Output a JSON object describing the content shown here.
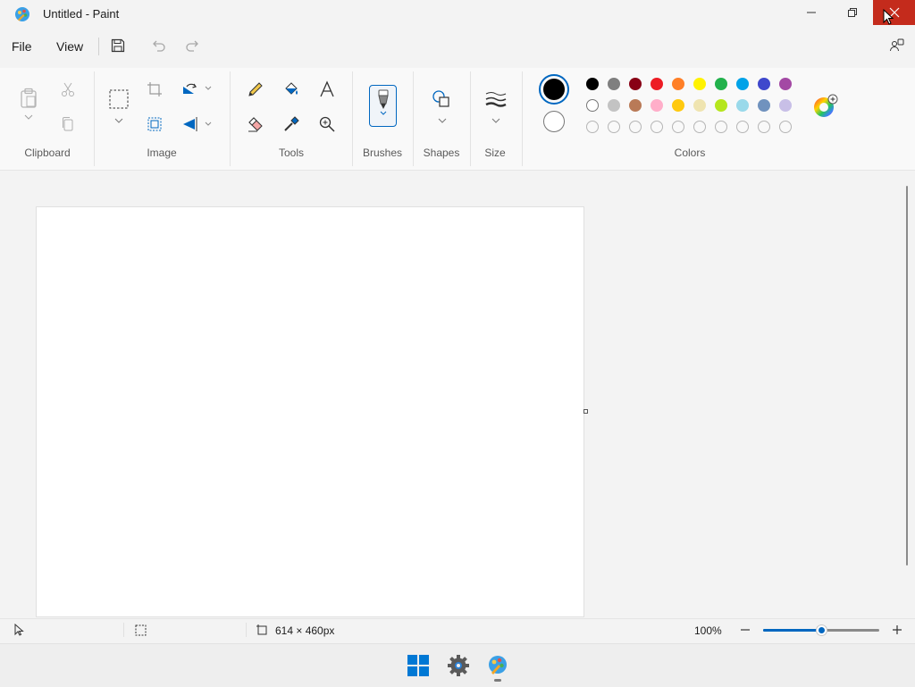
{
  "window": {
    "title": "Untitled - Paint"
  },
  "menu": {
    "file": "File",
    "view": "View"
  },
  "ribbon": {
    "groups": {
      "clipboard": "Clipboard",
      "image": "Image",
      "tools": "Tools",
      "brushes": "Brushes",
      "shapes": "Shapes",
      "size": "Size",
      "colors": "Colors"
    }
  },
  "colors": {
    "primary": "#000000",
    "secondary": "#ffffff",
    "row1": [
      "#000000",
      "#7f7f7f",
      "#880015",
      "#ed1c24",
      "#ff7f27",
      "#fff200",
      "#22b14c",
      "#00a2e8",
      "#3f48cc",
      "#a349a4"
    ],
    "row2": [
      "#ffffff",
      "#c3c3c3",
      "#b97a57",
      "#ffaec9",
      "#ffc90e",
      "#efe4b0",
      "#b5e61d",
      "#99d9ea",
      "#7092be",
      "#c8bfe7"
    ],
    "row3_empty": 10,
    "accent": "#0067c0",
    "close_hover": "#c42b1c"
  },
  "status": {
    "canvas_size": "614 × 460px",
    "zoom": "100%",
    "zoom_level": 0.5
  }
}
